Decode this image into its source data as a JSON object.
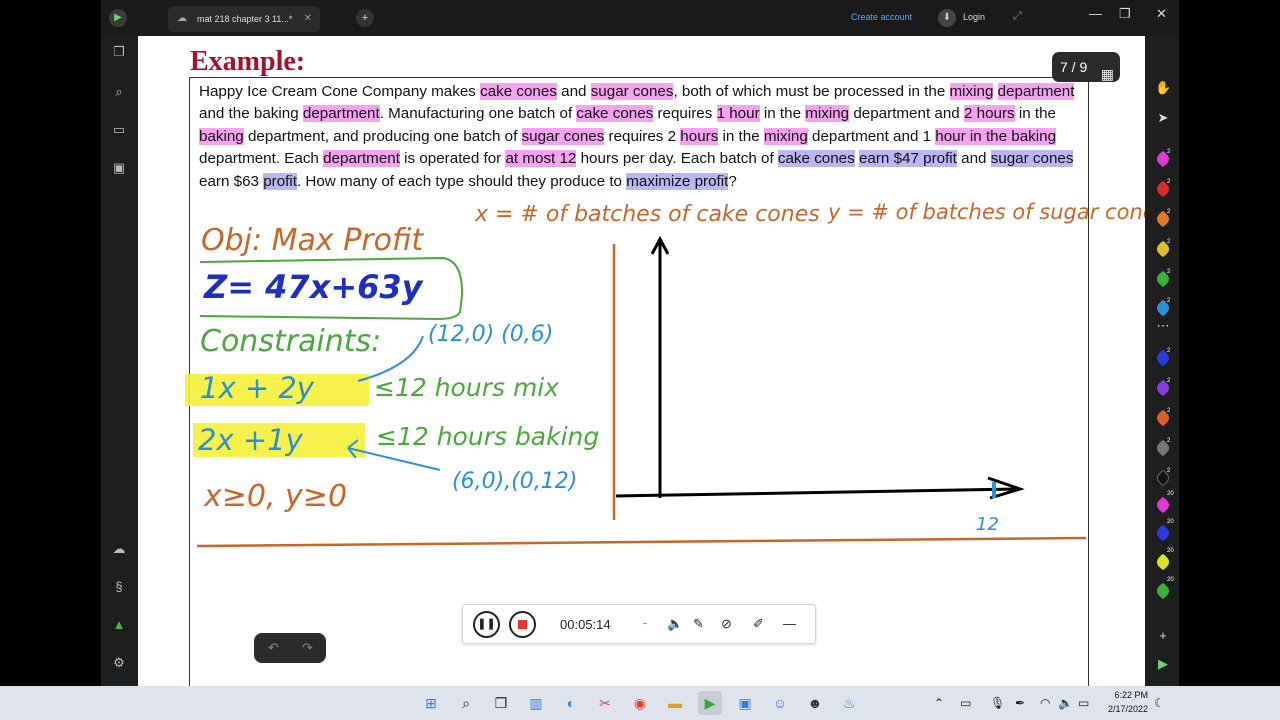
{
  "titlebar": {
    "tab_title": "mat 218 chapter 3 11...*",
    "create_account": "Create account",
    "login": "Login"
  },
  "page": {
    "heading": "Example:",
    "counter": "7 / 9",
    "problem": {
      "p1": "Happy Ice Cream Cone Company makes ",
      "h1": "cake cones",
      "p2": " and ",
      "h2": "sugar cones",
      "p3": ", both of which must be processed in the ",
      "h3": "mixing",
      "p4": " ",
      "h4": "department",
      "p5": " and the baking ",
      "h5": "department",
      "p6": ". Manufacturing one batch of ",
      "h6": "cake cones",
      "p7": " requires ",
      "h7": "1 hour",
      "p8": " in the ",
      "h8": "mixing",
      "p9": " department and ",
      "h9": "2 hours",
      "p10": " in the ",
      "h10": "baking",
      "p11": " department, and producing one batch of ",
      "h11": "sugar cones",
      "p12": " requires 2 ",
      "h12": "hours",
      "p13": " in the ",
      "h13": "mixing",
      "p14": " department and 1 ",
      "h14": "hour in the baking",
      "p15": " department. Each ",
      "h15": "department",
      "p16": " is operated for ",
      "h16": "at most 12",
      "p17": " hours per day. Each batch of ",
      "b1": "cake cones",
      "p18": " ",
      "b2": "earn $47 profit",
      "p19": " and ",
      "b3": "sugar cones",
      "p20": " earn $63 ",
      "b4": "profit",
      "p21": ". How many of each type should they produce to ",
      "b5": "maximize profit",
      "p22": "?"
    }
  },
  "ink": {
    "x_def": "x = # of batches of cake cones",
    "y_def": "y = # of batches of sugar cones",
    "obj": "Obj: Max Profit",
    "z": "Z= 47x+63y",
    "constraints": "Constraints:",
    "pts1": "(12,0) (0,6)",
    "c1_lhs": "1x + 2y",
    "c1_rhs": "≤12 hours mix",
    "c2_lhs": "2x +1y",
    "c2_rhs": "≤12 hours baking",
    "pts2": "(6,0),(0,12)",
    "nonneg": "x≥0, y≥0",
    "tick": "12"
  },
  "recorder": {
    "time": "00:05:14"
  },
  "taskbar": {
    "time": "6:22 PM",
    "date": "2/17/2022"
  },
  "colors": {
    "heading": "#a3122c",
    "ink_orange": "#c8662a",
    "ink_green": "#4aa83c",
    "ink_blue": "#1d2fbd",
    "ink_lightblue": "#2b8fd6",
    "highlight_yellow": "#f6f03a",
    "highlight_pink": "#f5a3f0",
    "highlight_blue": "#b9b7f5"
  }
}
